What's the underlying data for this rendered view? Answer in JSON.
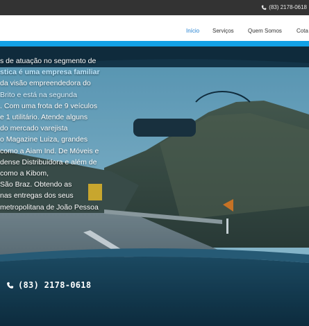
{
  "topbar": {
    "phone": "(83) 2178-0618"
  },
  "nav": {
    "items": [
      {
        "label": "Início",
        "active": true
      },
      {
        "label": "Serviços",
        "active": false
      },
      {
        "label": "Quem Somos",
        "active": false
      },
      {
        "label": "Cota",
        "active": false
      }
    ]
  },
  "hero": {
    "lines": [
      "s de atuação no segmento de",
      "stica é uma empresa familiar",
      "da visão empreendedora do",
      " Brito e  está na segunda",
      ". Com uma frota de 9 veículos",
      "e 1 utilitário. Atende alguns",
      " do mercado varejista",
      "o Magazine Luiza, grandes",
      " como a Aiam Ind. De Móveis e",
      "dense Distribuidora e além de",
      " como a Kibom,",
      "São Braz. Obtendo as",
      " nas entregas dos seus",
      "metropolitana de João Pessoa"
    ],
    "phone": "(83) 2178-0618"
  },
  "colors": {
    "topbar": "#333333",
    "accent": "#13a1e6",
    "nav_active": "#1f7fd1"
  }
}
